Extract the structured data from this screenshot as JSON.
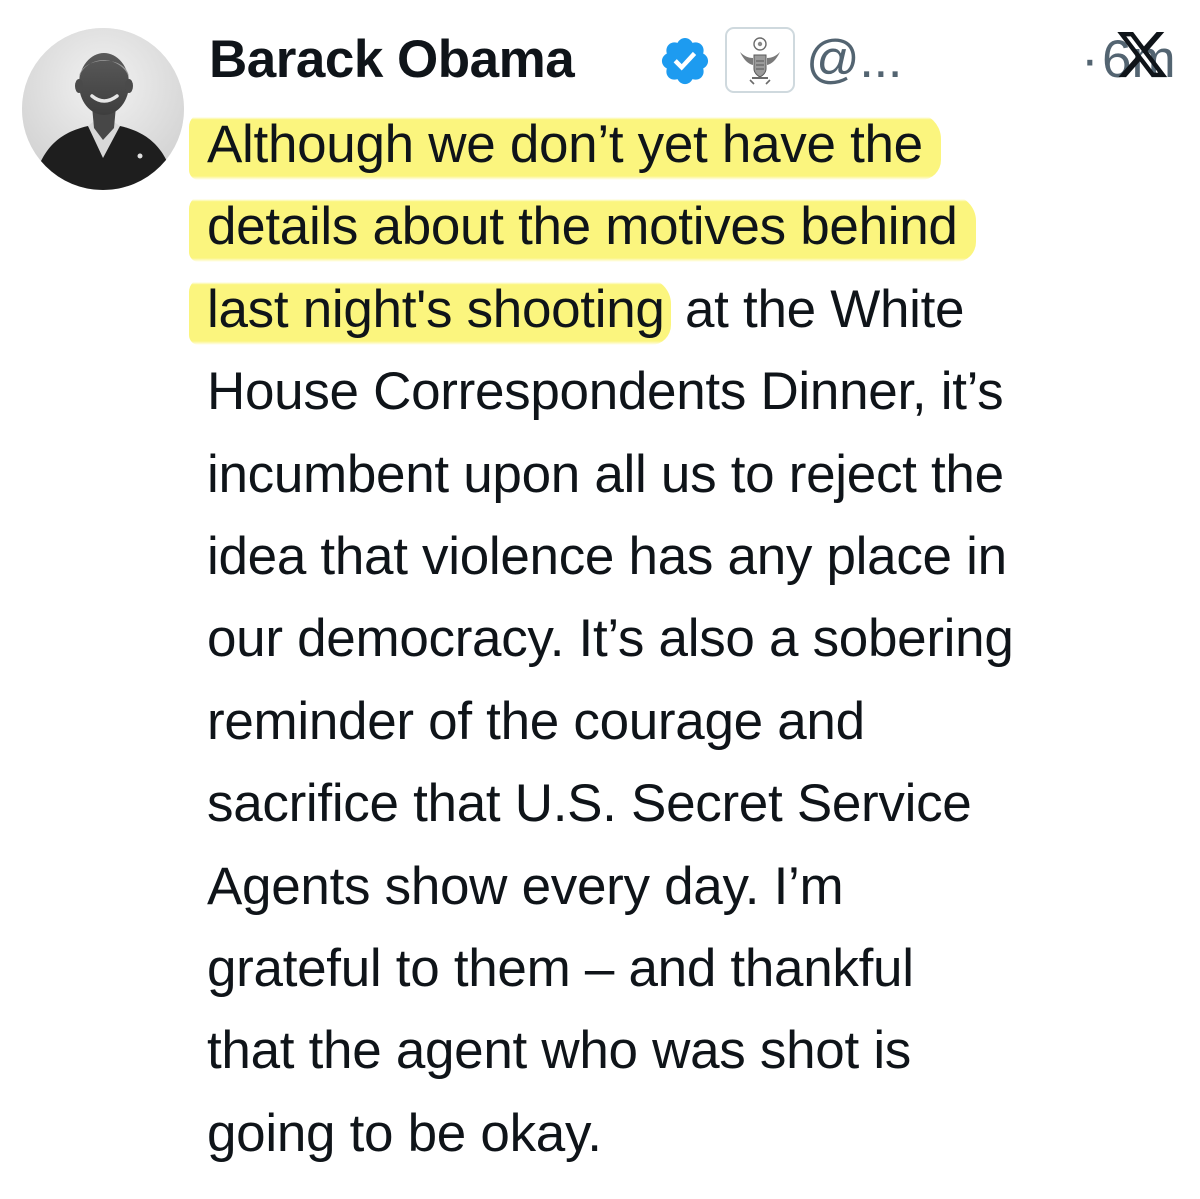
{
  "tweet": {
    "author": {
      "display_name": "Barack Obama",
      "verified": true,
      "affiliation_badge": "us-seal-icon",
      "handle": "@...",
      "avatar_icon": "profile-photo"
    },
    "separator": "·",
    "timestamp": "6m",
    "platform_icon": "x-logo-icon",
    "colors": {
      "text": "#0f1419",
      "secondary_text": "#536471",
      "verified_blue": "#1d9bf0",
      "highlight": "#fbf57e"
    },
    "body_lines": [
      "Although we don’t yet have the",
      "details about the motives behind",
      "last night's shooting",
      " at the White",
      "House Correspondents Dinner, it’s",
      "incumbent upon all us to reject the",
      "idea that violence has any place in",
      "our democracy. It’s also a sobering",
      "reminder of the courage and",
      "sacrifice that U.S. Secret Service",
      "Agents show every day. I’m",
      "grateful to them – and thankful",
      "that the agent who was shot is",
      "going to be okay."
    ],
    "highlighted_text": "Although we don’t yet have the details about the motives behind last night's shooting"
  }
}
